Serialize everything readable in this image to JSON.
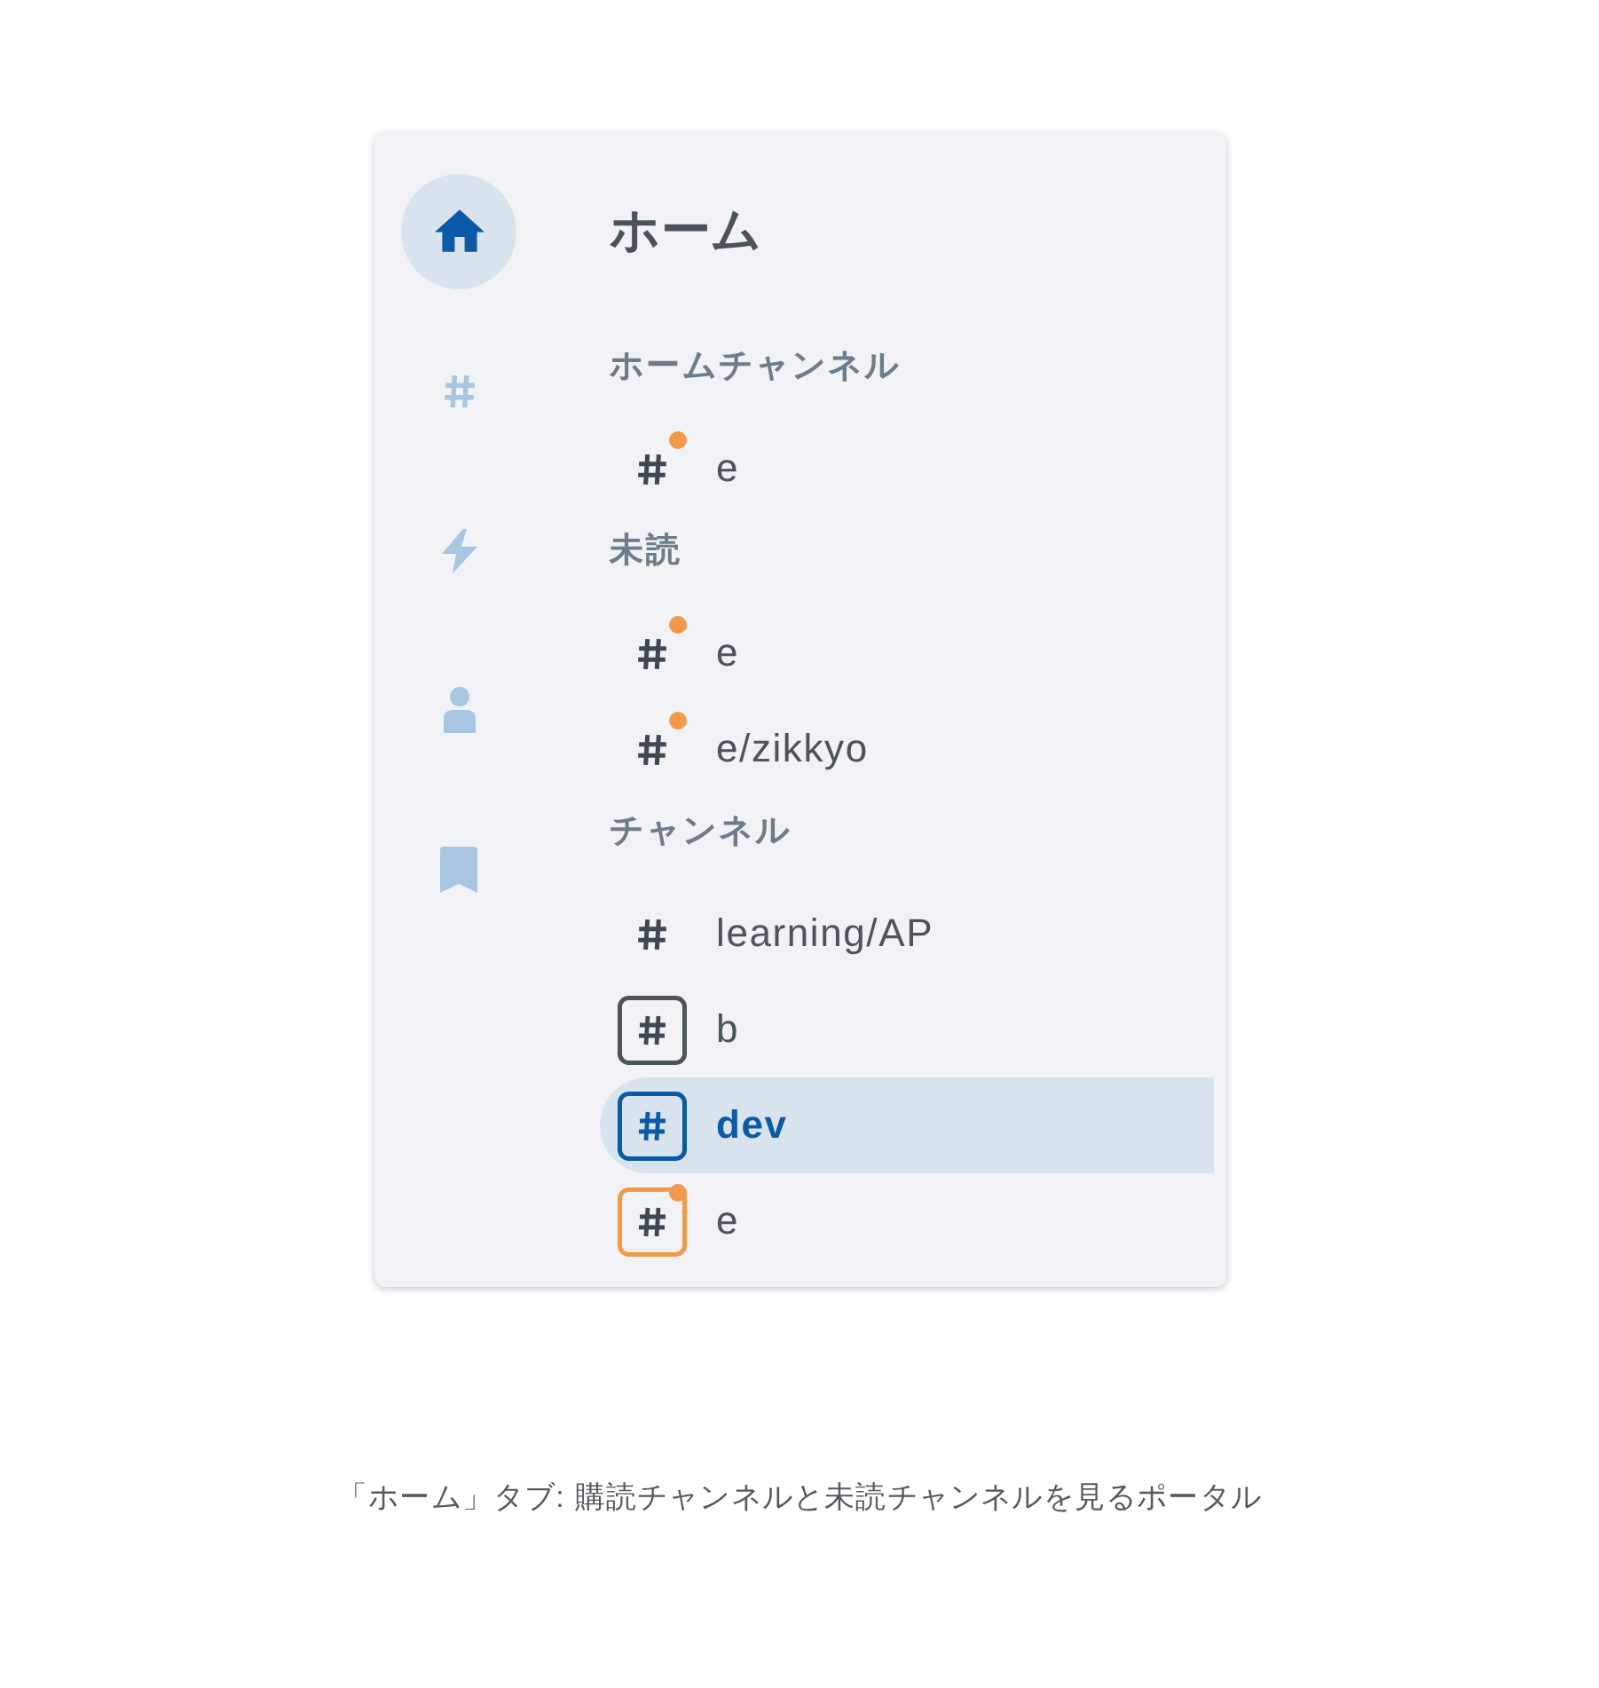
{
  "rail": {
    "items": [
      {
        "kind": "home",
        "selected": true
      },
      {
        "kind": "hash",
        "selected": false
      },
      {
        "kind": "bolt",
        "selected": false
      },
      {
        "kind": "person",
        "selected": false
      },
      {
        "kind": "bookmark",
        "selected": false
      }
    ]
  },
  "panel": {
    "title": "ホーム",
    "sections": [
      {
        "heading": "ホームチャンネル",
        "channels": [
          {
            "name": "e",
            "kind": "hash",
            "unread": true,
            "selected": false
          }
        ]
      },
      {
        "heading": "未読",
        "channels": [
          {
            "name": "e",
            "kind": "hash",
            "unread": true,
            "selected": false
          },
          {
            "name": "e/zikkyo",
            "kind": "hash",
            "unread": true,
            "selected": false
          }
        ]
      },
      {
        "heading": "チャンネル",
        "channels": [
          {
            "name": "learning/AP",
            "kind": "hash",
            "unread": false,
            "selected": false
          },
          {
            "name": "b",
            "kind": "framed",
            "unread": false,
            "selected": false
          },
          {
            "name": "dev",
            "kind": "framed",
            "unread": false,
            "selected": true
          },
          {
            "name": "e",
            "kind": "framed",
            "unread": true,
            "selected": false
          }
        ]
      }
    ]
  },
  "caption": "「ホーム」タブ: 購読チャンネルと未読チャンネルを見るポータル"
}
